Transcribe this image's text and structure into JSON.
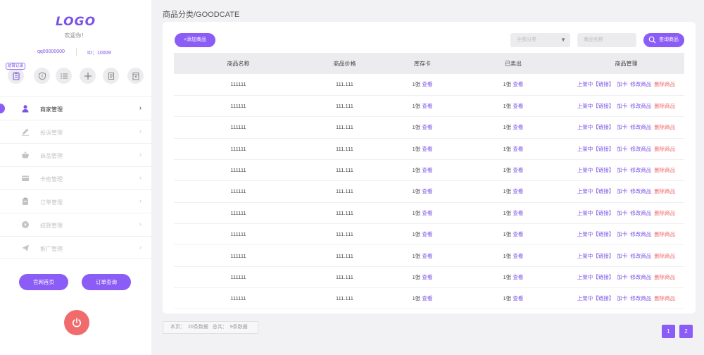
{
  "sidebar": {
    "logo": "LOGO",
    "welcome": "欢迎你！",
    "qq": "qq00000000",
    "user_id": "ID：10009",
    "quick_badge": "结算记录",
    "quick_icons": [
      "clipboard-icon",
      "shield-icon",
      "list-icon",
      "plus-icon",
      "document-icon",
      "trash-bin-icon"
    ],
    "menu": [
      {
        "label": "商家管理",
        "icon": "user-icon",
        "active": true
      },
      {
        "label": "投诉管理",
        "icon": "pencil-icon",
        "active": false
      },
      {
        "label": "商品管理",
        "icon": "basket-icon",
        "active": false
      },
      {
        "label": "卡密管理",
        "icon": "card-icon",
        "active": false
      },
      {
        "label": "订单管理",
        "icon": "clipboard-icon",
        "active": false
      },
      {
        "label": "结算管理",
        "icon": "coin-icon",
        "active": false
      },
      {
        "label": "推广管理",
        "icon": "send-icon",
        "active": false
      }
    ],
    "home_button": "官网首页",
    "order_query_button": "订单查询"
  },
  "main": {
    "breadcrumb": "商品分类/GOODCATE",
    "add_button": "+添加商品",
    "filter_select": "全部分类",
    "name_placeholder": "商品名称",
    "search_button": "查询商品",
    "columns": [
      "商品名称",
      "商品价格",
      "库存卡",
      "已卖出",
      "商品管理"
    ],
    "rows": [
      {
        "name": "111111",
        "price": "111.111",
        "stock": "1张",
        "sold": "1张"
      },
      {
        "name": "111111",
        "price": "111.111",
        "stock": "1张",
        "sold": "1张"
      },
      {
        "name": "111111",
        "price": "111.111",
        "stock": "1张",
        "sold": "1张"
      },
      {
        "name": "111111",
        "price": "111.111",
        "stock": "1张",
        "sold": "1张"
      },
      {
        "name": "111111",
        "price": "111.111",
        "stock": "1张",
        "sold": "1张"
      },
      {
        "name": "111111",
        "price": "111.111",
        "stock": "1张",
        "sold": "1张"
      },
      {
        "name": "111111",
        "price": "111.111",
        "stock": "1张",
        "sold": "1张"
      },
      {
        "name": "111111",
        "price": "111.111",
        "stock": "1张",
        "sold": "1张"
      },
      {
        "name": "111111",
        "price": "111.111",
        "stock": "1张",
        "sold": "1张"
      },
      {
        "name": "111111",
        "price": "111.111",
        "stock": "1张",
        "sold": "1张"
      },
      {
        "name": "111111",
        "price": "111.111",
        "stock": "1张",
        "sold": "1张"
      }
    ],
    "view_link": "查看",
    "ops": {
      "status": "上架中",
      "link": "【链接】",
      "add_card": "加卡",
      "edit": "修改商品",
      "delete": "删除商品"
    }
  },
  "footer": {
    "this_page": "本页：",
    "this_page_count": "20条数据",
    "total": "总共：",
    "total_count": "9条数据",
    "pages": [
      "1",
      "2"
    ]
  },
  "colors": {
    "accent": "#8b5cf6",
    "danger": "#ef6b6b",
    "power": "#f06b6b"
  }
}
